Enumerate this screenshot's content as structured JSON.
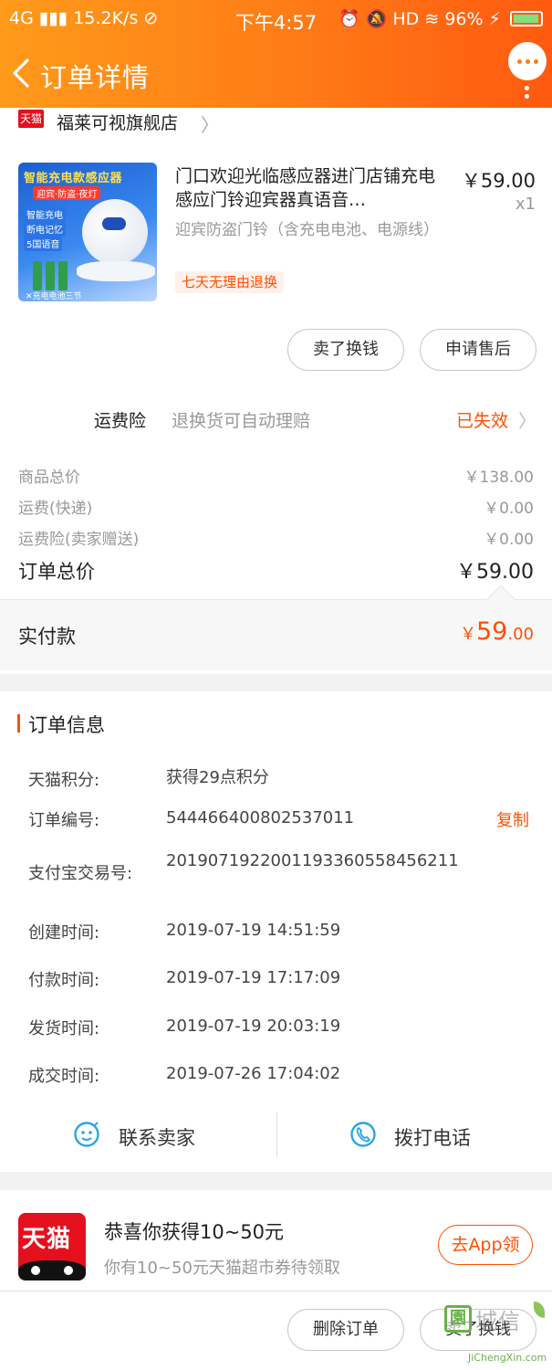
{
  "status_bar": {
    "network": "4G",
    "speed": "15.2K/s",
    "time": "下午4:57",
    "indicators": "HD",
    "battery": "96%"
  },
  "nav": {
    "title": "订单详情",
    "back_icon": "chevron-left-icon",
    "more_icon": "more-dots-icon"
  },
  "store": {
    "badge": "天猫",
    "name": "福莱可视旗舰店"
  },
  "product": {
    "image_texts": {
      "headline": "智能充电款感应器",
      "subline": "迎宾·防盗·夜灯",
      "tags": [
        "智能充电",
        "断电记忆",
        "5国语音"
      ],
      "footnote": "✕充电电池三节"
    },
    "title": "门口欢迎光临感应器进门店铺充电感应门铃迎宾器真语音…",
    "price": "￥59.00",
    "qty": "x1",
    "sku": "迎宾防盗门铃（含充电电池、电源线）",
    "return_tag": "七天无理由退换"
  },
  "actions": {
    "sell_trade": "卖了换钱",
    "after_sale": "申请售后"
  },
  "insurance": {
    "label": "运费险",
    "desc": "退换货可自动理赔",
    "status": "已失效"
  },
  "fees": [
    {
      "label": "商品总价",
      "value": "￥138.00"
    },
    {
      "label": "运费(快递)",
      "value": "￥0.00"
    },
    {
      "label": "运费险(卖家赠送)",
      "value": "￥0.00"
    }
  ],
  "total": {
    "label": "订单总价",
    "value": "￥59.00"
  },
  "paid": {
    "label": "实付款",
    "currency": "￥",
    "integer": "59",
    "decimal": ".00"
  },
  "order_info": {
    "title": "订单信息",
    "rows": [
      {
        "label": "天猫积分:",
        "value": "获得29点积分"
      },
      {
        "label": "订单编号:",
        "value": "544466400802537011"
      },
      {
        "label": "支付宝交易号:",
        "value": "2019071922001193360558456211"
      },
      {
        "label": "创建时间:",
        "value": "2019-07-19 14:51:59"
      },
      {
        "label": "付款时间:",
        "value": "2019-07-19 17:17:09"
      },
      {
        "label": "发货时间:",
        "value": "2019-07-19 20:03:19"
      },
      {
        "label": "成交时间:",
        "value": "2019-07-26 17:04:02"
      }
    ],
    "copy": "复制"
  },
  "contact": {
    "seller": "联系卖家",
    "phone": "拨打电话"
  },
  "promo": {
    "logo_text": "天猫",
    "title": "恭喜你获得10~50元",
    "sub": "你有10~50元天猫超市券待领取",
    "button": "去App领"
  },
  "bottom": {
    "delete": "删除订单",
    "sell_trade": "卖了换钱"
  },
  "watermark": {
    "box": "園",
    "text": "城信",
    "url": "JiChengXin.com"
  },
  "colors": {
    "accent": "#ff5000",
    "header_start": "#ff9a1a",
    "header_end": "#ff5a10",
    "contact_icon": "#2aa3e8"
  }
}
